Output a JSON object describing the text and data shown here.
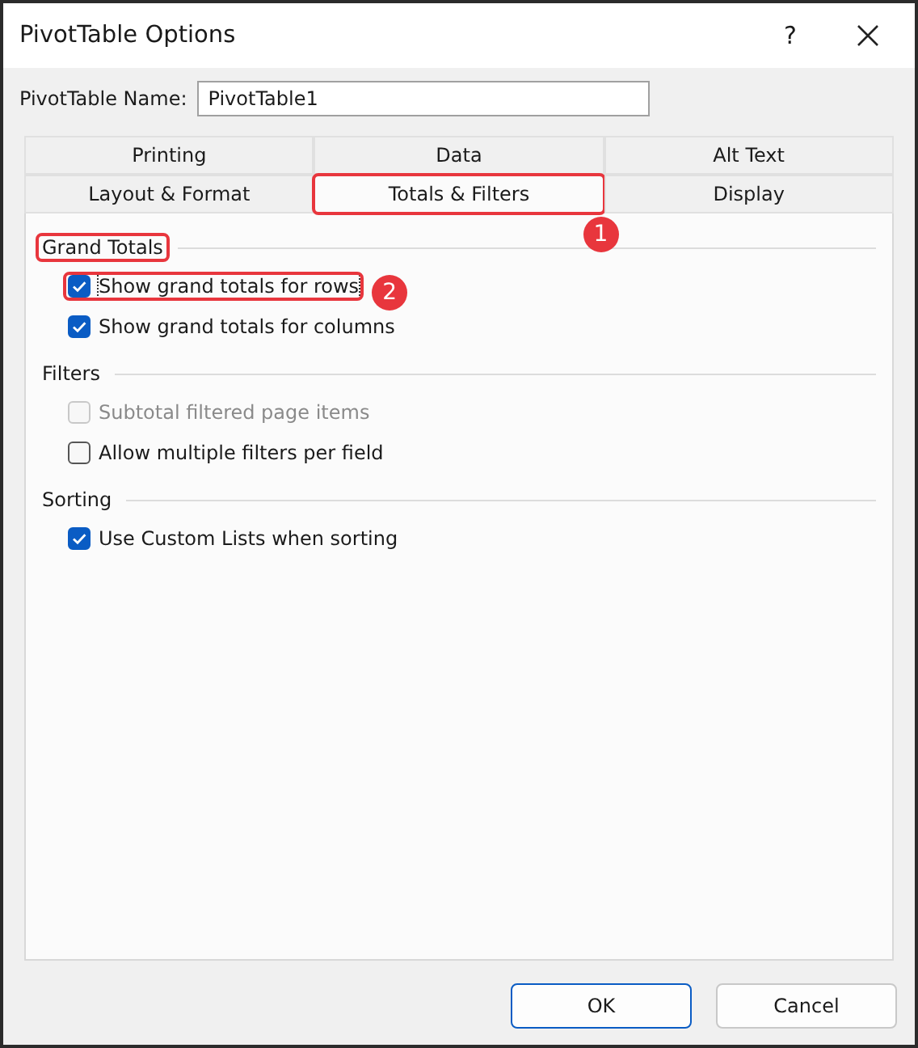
{
  "window": {
    "title": "PivotTable Options",
    "help": "?"
  },
  "name_field": {
    "label": "PivotTable Name:",
    "value": "PivotTable1"
  },
  "tab_rows": [
    {
      "tabs": [
        {
          "label": "Printing",
          "selected": false
        },
        {
          "label": "Data",
          "selected": false
        },
        {
          "label": "Alt Text",
          "selected": false
        }
      ]
    },
    {
      "tabs": [
        {
          "label": "Layout & Format",
          "selected": false
        },
        {
          "label": "Totals & Filters",
          "selected": true,
          "annotation": "1"
        },
        {
          "label": "Display",
          "selected": false
        }
      ]
    }
  ],
  "sections": [
    {
      "title": "Grand Totals",
      "highlighted": true,
      "options": [
        {
          "label": "Show grand totals for rows",
          "checked": true,
          "disabled": false,
          "focused": true,
          "annotation": "2"
        },
        {
          "label": "Show grand totals for columns",
          "checked": true,
          "disabled": false,
          "focused": false
        }
      ]
    },
    {
      "title": "Filters",
      "highlighted": false,
      "options": [
        {
          "label": "Subtotal filtered page items",
          "checked": false,
          "disabled": true,
          "focused": false
        },
        {
          "label": "Allow multiple filters per field",
          "checked": false,
          "disabled": false,
          "focused": false
        }
      ]
    },
    {
      "title": "Sorting",
      "highlighted": false,
      "options": [
        {
          "label": "Use Custom Lists when sorting",
          "checked": true,
          "disabled": false,
          "focused": false
        }
      ]
    }
  ],
  "buttons": [
    {
      "label": "OK",
      "default": true
    },
    {
      "label": "Cancel",
      "default": false
    }
  ]
}
